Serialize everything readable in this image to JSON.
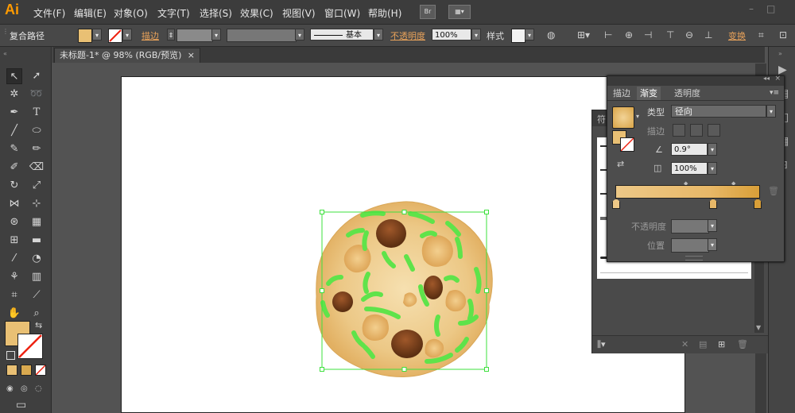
{
  "app": {
    "logo": "Ai"
  },
  "menu": [
    "文件(F)",
    "编辑(E)",
    "对象(O)",
    "文字(T)",
    "选择(S)",
    "效果(C)",
    "视图(V)",
    "窗口(W)",
    "帮助(H)"
  ],
  "menu_buttons": {
    "bridge": "Br"
  },
  "control_bar": {
    "object_type": "复合路径",
    "stroke_label": "描边",
    "profile_label": "基本",
    "opacity_label": "不透明度",
    "opacity_value": "100%",
    "style_label": "样式",
    "transform_label": "变换"
  },
  "document_tab": {
    "title": "未标题-1* @ 98% (RGB/预览)"
  },
  "colors": {
    "fill": "#e9c074",
    "gradient_start": "#edc887",
    "gradient_end": "#d99f38",
    "cookie_base": "#e7be7a",
    "sprinkles": "#5fe34a",
    "chips": "#6e3d1b",
    "selection": "#3ee03e"
  },
  "gradient_panel": {
    "tabs": [
      "描边",
      "渐变",
      "透明度"
    ],
    "active_tab": "渐变",
    "type_label": "类型",
    "type_value": "径向",
    "stroke_label": "描边",
    "angle_value": "0.9°",
    "aspect_value": "100%",
    "opacity_label": "不透明度",
    "location_label": "位置"
  },
  "brush_panel": {
    "title": "符"
  }
}
